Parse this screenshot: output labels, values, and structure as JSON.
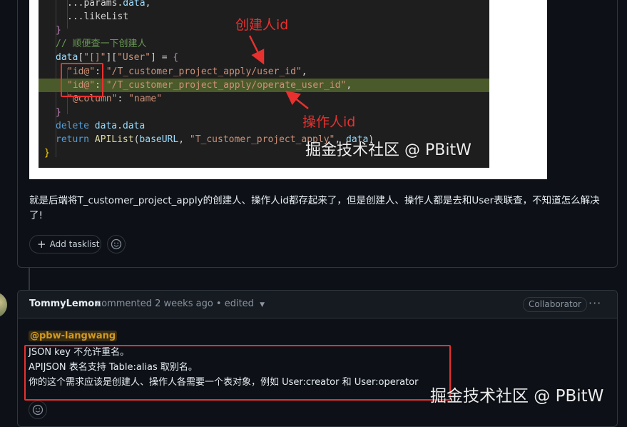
{
  "code": {
    "lines": [
      {
        "parts": [
          [
            "t-spread",
            "...params."
          ],
          [
            "t-var",
            "data"
          ],
          [
            "t-pl",
            ","
          ]
        ]
      },
      {
        "parts": [
          [
            "t-spread",
            "...likeList"
          ]
        ]
      },
      {
        "parts": [
          [
            "t-brace",
            "}"
          ]
        ]
      },
      {
        "parts": [
          [
            "t-cm",
            "// 顺便查一下创建人"
          ]
        ]
      },
      {
        "parts": [
          [
            "t-var",
            "data"
          ],
          [
            "t-pl",
            "["
          ],
          [
            "t-str",
            "\"[]\""
          ],
          [
            "t-pl",
            "]["
          ],
          [
            "t-str",
            "\"User\""
          ],
          [
            "t-pl",
            "] = "
          ],
          [
            "t-brace",
            "{"
          ]
        ]
      },
      {
        "parts": [
          [
            "t-str",
            "\"id@\""
          ],
          [
            "t-pl",
            ": "
          ],
          [
            "t-str",
            "\"/T_customer_project_apply/user_id\""
          ],
          [
            "t-pl",
            ","
          ]
        ]
      },
      {
        "parts": [
          [
            "t-str",
            "\"id@\""
          ],
          [
            "t-pl",
            ": "
          ],
          [
            "t-str",
            "\"/T_customer_project_apply/operate_user_id\""
          ],
          [
            "t-pl",
            ","
          ]
        ]
      },
      {
        "parts": [
          [
            "t-str",
            "\"@column\""
          ],
          [
            "t-pl",
            ": "
          ],
          [
            "t-str",
            "\"name\""
          ]
        ]
      },
      {
        "parts": [
          [
            "t-brace",
            "}"
          ]
        ]
      },
      {
        "parts": [
          [
            "t-kw",
            "delete "
          ],
          [
            "t-var",
            "data"
          ],
          [
            "t-pl",
            "."
          ],
          [
            "t-var",
            "data"
          ]
        ]
      },
      {
        "parts": [
          [
            "t-kw",
            "return "
          ],
          [
            "t-fn",
            "APIList"
          ],
          [
            "t-pl",
            "("
          ],
          [
            "t-var",
            "baseURL"
          ],
          [
            "t-pl",
            ", "
          ],
          [
            "t-str",
            "\"T_customer_project_apply\""
          ],
          [
            "t-pl",
            ", "
          ],
          [
            "t-var",
            "data"
          ],
          [
            "t-pl",
            ")"
          ]
        ]
      },
      {
        "parts": [
          [
            "t-brace2",
            "}"
          ]
        ]
      }
    ],
    "annotation_creator": "创建人id",
    "annotation_operator": "操作人id",
    "watermark": "掘金技术社区 @ PBitW"
  },
  "comment1": {
    "body": "就是后端将T_customer_project_apply的创建人、操作人id都存起来了，但是创建人、操作人都是去和User表联查，不知道怎么解决了!",
    "add_tasklist_label": "Add tasklist"
  },
  "comment2": {
    "author": "TommyLemon",
    "meta": "commented 2 weeks ago • edited",
    "role_badge": "Collaborator",
    "mention": "@pbw-langwang",
    "lines": [
      "JSON key 不允许重名。",
      "APIJSON 表名支持 Table:alias 取别名。",
      "你的这个需求应该是创建人、操作人各需要一个表对象，例如 User:creator 和 User:operator"
    ],
    "watermark": "掘金技术社区 @ PBitW"
  }
}
